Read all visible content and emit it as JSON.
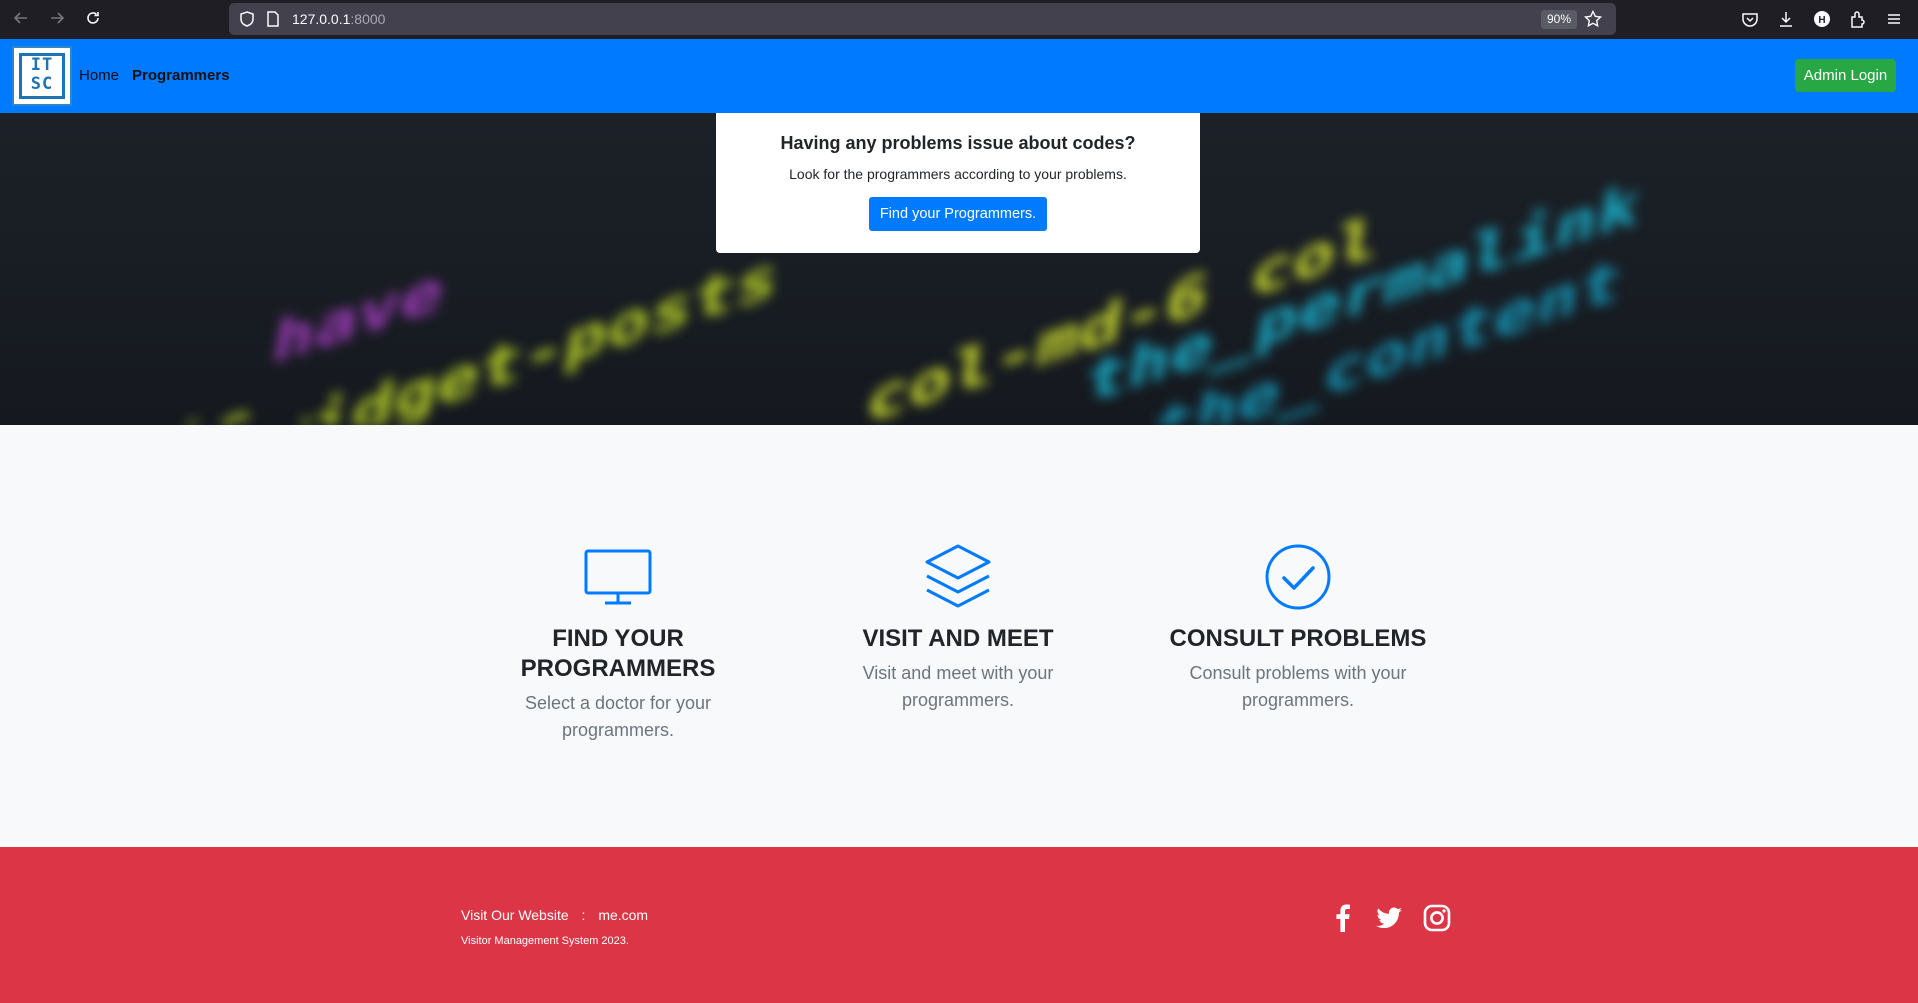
{
  "browser": {
    "url_host": "127.0.0.1",
    "url_port": ":8000",
    "zoom": "90%"
  },
  "navbar": {
    "logo_text": "IT SC",
    "home": "Home",
    "programmers": "Programmers",
    "admin_login": "Admin Login"
  },
  "hero": {
    "title": "Having any problems issue about codes?",
    "subtitle": "Look for the programmers according to your problems.",
    "button": "Find your Programmers."
  },
  "features": [
    {
      "icon": "monitor-icon",
      "title": "FIND YOUR PROGRAMMERS",
      "text": "Select a doctor for your programmers."
    },
    {
      "icon": "layers-icon",
      "title": "VISIT AND MEET",
      "text": "Visit and meet with your programmers."
    },
    {
      "icon": "check-circle-icon",
      "title": "CONSULT PROBLEMS",
      "text": "Consult problems with your programmers."
    }
  ],
  "footer": {
    "visit_label": "Visit Our Website",
    "separator": ":",
    "website": "me.com",
    "copyright": "Visitor Management System 2023.",
    "social": [
      "facebook-icon",
      "twitter-icon",
      "instagram-icon"
    ]
  },
  "colors": {
    "primary": "#007bff",
    "success": "#28a745",
    "danger": "#dc3545"
  }
}
